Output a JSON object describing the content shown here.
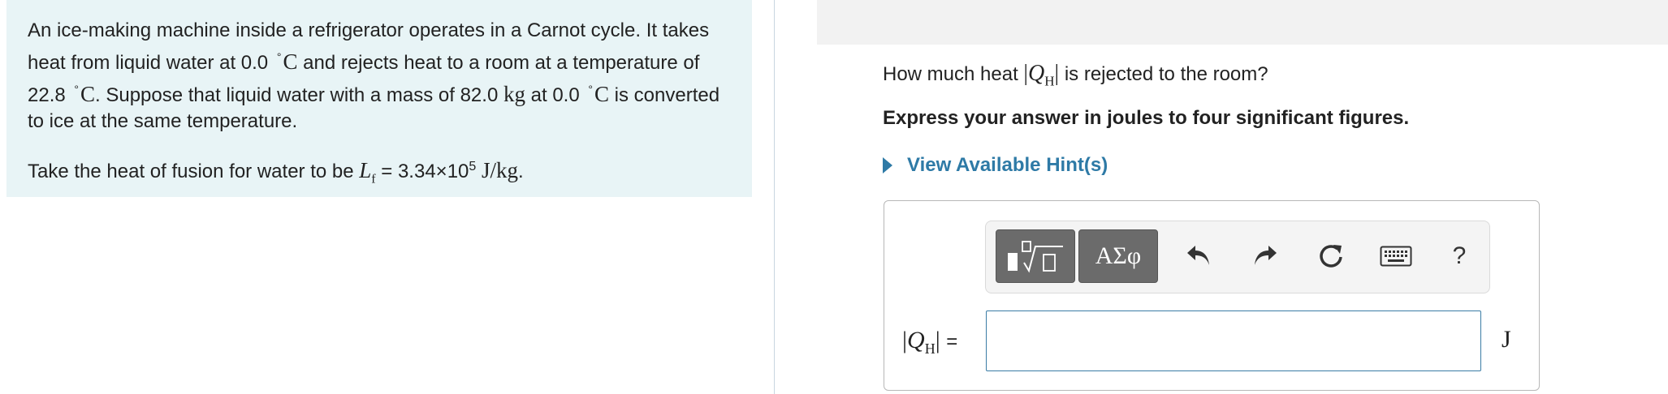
{
  "problem": {
    "p1_a": "An ice-making machine inside a refrigerator operates in a Carnot cycle. It takes heat from liquid water at 0.0",
    "p1_unit_c1": "C",
    "p1_b": "and rejects heat to a room at a temperature of 22.8",
    "p1_unit_c2": "C",
    "p1_c": ". Suppose that liquid water with a mass of 82.0",
    "p1_unit_kg": "kg",
    "p1_d": "at 0.0",
    "p1_unit_c3": "C",
    "p1_e": "is converted to ice at the same temperature.",
    "p2_a": "Take the heat of fusion for water to be",
    "p2_sym": "L",
    "p2_sub": "f",
    "p2_eq": " = 3.34×10",
    "p2_exp": "5",
    "p2_unit": "J/kg",
    "p2_end": "."
  },
  "question": {
    "text_a": "How much heat",
    "symbol": "Q",
    "symbol_sub": "H",
    "text_b": "is rejected to the room?",
    "instruction": "Express your answer in joules to four significant figures.",
    "hint_label": "View Available Hint(s)"
  },
  "toolbar": {
    "greek_label": "ΑΣφ",
    "help_label": "?",
    "icons": [
      "templates-icon",
      "greek-symbols-icon",
      "undo-icon",
      "redo-icon",
      "reset-icon",
      "keyboard-icon",
      "help-icon"
    ]
  },
  "answer": {
    "label_sym": "Q",
    "label_sub": "H",
    "label_eq": "=",
    "value": "",
    "unit": "J"
  },
  "colors": {
    "panel_bg": "#e8f4f6",
    "hint": "#2e7aa6",
    "input_border": "#3a7ca5"
  }
}
